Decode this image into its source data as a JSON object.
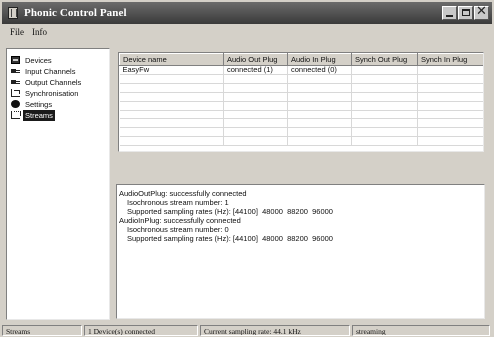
{
  "window": {
    "title": "Phonic Control Panel"
  },
  "menu": {
    "file": "File",
    "info": "Info"
  },
  "sidebar": {
    "items": [
      {
        "label": "Devices",
        "icon": "devices-icon"
      },
      {
        "label": "Input Channels",
        "icon": "plug-icon"
      },
      {
        "label": "Output Channels",
        "icon": "plug-icon"
      },
      {
        "label": "Synchronisation",
        "icon": "sync-icon"
      },
      {
        "label": "Settings",
        "icon": "settings-icon"
      },
      {
        "label": "Streams",
        "icon": "streams-icon",
        "selected": true
      }
    ]
  },
  "table": {
    "columns": [
      "Device name",
      "Audio Out Plug",
      "Audio In Plug",
      "Synch Out Plug",
      "Synch In Plug"
    ],
    "rows": [
      [
        "EasyFw",
        "connected (1)",
        "connected (0)",
        "",
        ""
      ]
    ]
  },
  "log": {
    "lines": [
      {
        "text": "AudioOutPlug: successfully connected",
        "indent": false
      },
      {
        "text": "Isochronous stream number: 1",
        "indent": true
      },
      {
        "text": "Supported sampling rates (Hz): [44100]  48000  88200  96000",
        "indent": true
      },
      {
        "text": "AudioInPlug: successfully connected",
        "indent": false
      },
      {
        "text": "Isochronous stream number: 0",
        "indent": true
      },
      {
        "text": "Supported sampling rates (Hz): [44100]  48000  88200  96000",
        "indent": true
      }
    ]
  },
  "status": {
    "mode": "Streams",
    "devices": "1 Device(s) connected",
    "sampling_rate": "Current sampling rate: 44.1 kHz",
    "state": "streaming"
  }
}
